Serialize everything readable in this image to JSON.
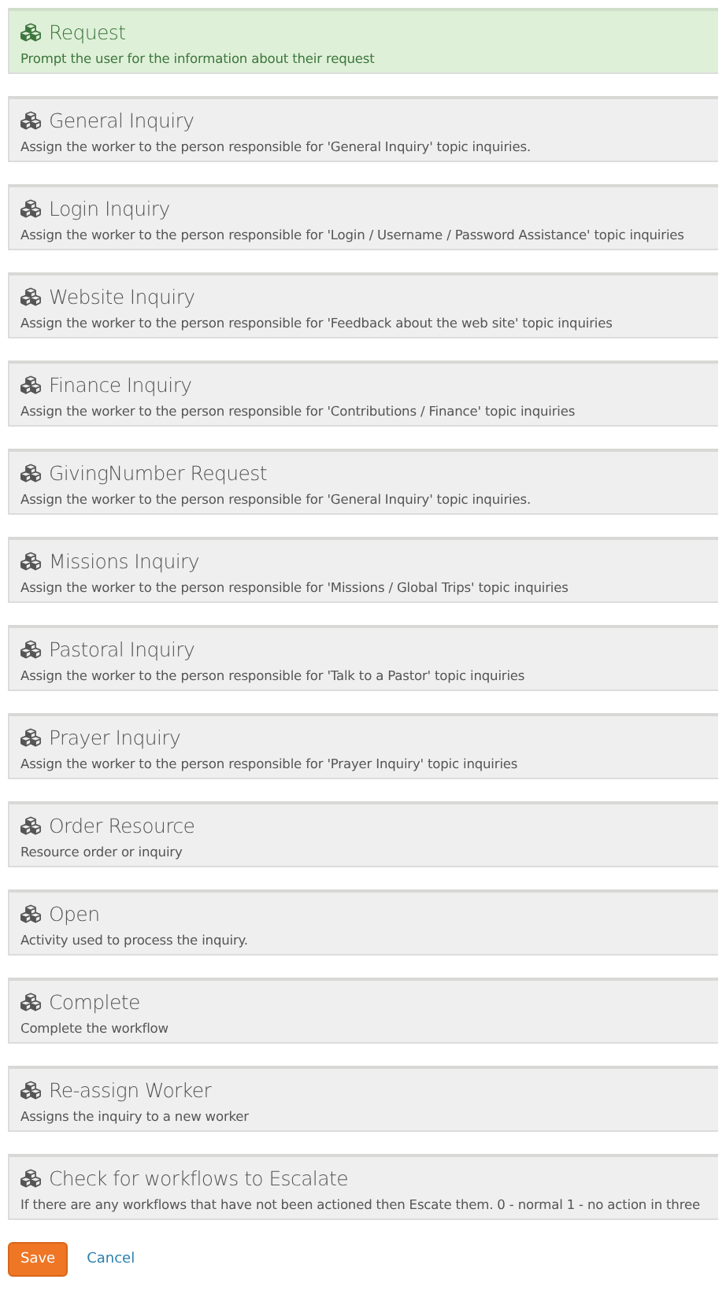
{
  "activities": [
    {
      "title": "Request",
      "description": "Prompt the user for the information about their request",
      "selected": true
    },
    {
      "title": "General Inquiry",
      "description": "Assign the worker to the person responsible for 'General Inquiry' topic inquiries.",
      "selected": false
    },
    {
      "title": "Login Inquiry",
      "description": "Assign the worker to the person responsible for 'Login / Username / Password Assistance' topic inquiries",
      "selected": false
    },
    {
      "title": "Website Inquiry",
      "description": "Assign the worker to the person responsible for 'Feedback about the web site' topic inquiries",
      "selected": false
    },
    {
      "title": "Finance Inquiry",
      "description": "Assign the worker to the person responsible for 'Contributions / Finance' topic inquiries",
      "selected": false
    },
    {
      "title": "GivingNumber Request",
      "description": "Assign the worker to the person responsible for 'General Inquiry' topic inquiries.",
      "selected": false
    },
    {
      "title": "Missions Inquiry",
      "description": "Assign the worker to the person responsible for 'Missions / Global Trips' topic inquiries",
      "selected": false
    },
    {
      "title": "Pastoral Inquiry",
      "description": "Assign the worker to the person responsible for 'Talk to a Pastor' topic inquiries",
      "selected": false
    },
    {
      "title": "Prayer Inquiry",
      "description": "Assign the worker to the person responsible for 'Prayer Inquiry' topic inquiries",
      "selected": false
    },
    {
      "title": "Order Resource",
      "description": "Resource order or inquiry",
      "selected": false
    },
    {
      "title": "Open",
      "description": "Activity used to process the inquiry.",
      "selected": false
    },
    {
      "title": "Complete",
      "description": "Complete the workflow",
      "selected": false
    },
    {
      "title": "Re-assign Worker",
      "description": "Assigns the inquiry to a new worker",
      "selected": false
    },
    {
      "title": "Check for workflows to Escalate",
      "description": "If there are any workflows that have not been actioned then Escate them. 0 - normal 1 - no action in three",
      "selected": false
    }
  ],
  "actions": {
    "save": "Save",
    "cancel": "Cancel"
  }
}
